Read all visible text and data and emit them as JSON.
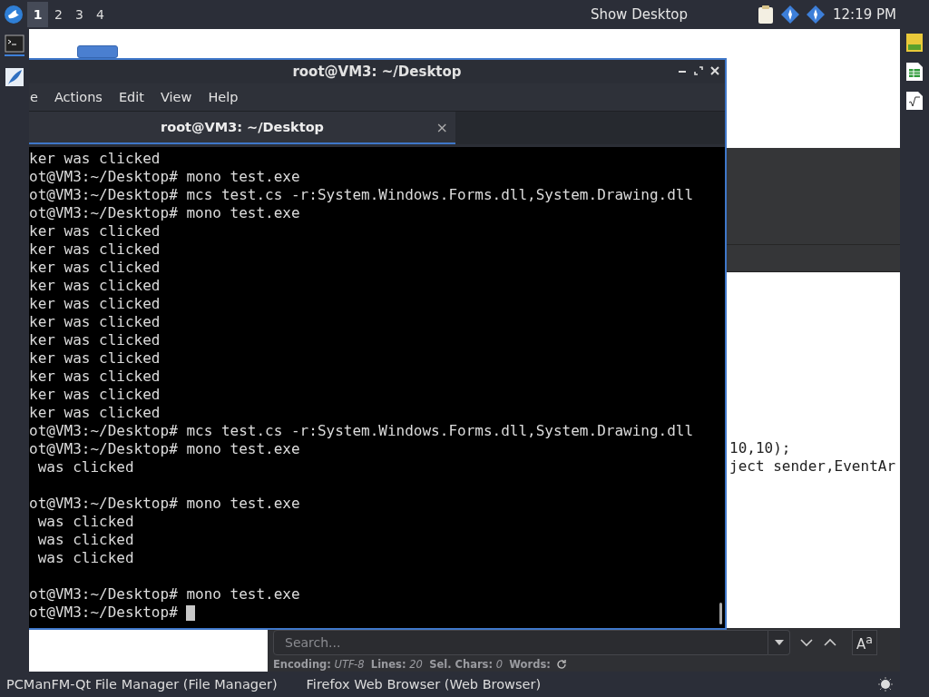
{
  "panel": {
    "workspaces": [
      {
        "label": "1",
        "selected": true
      },
      {
        "label": "2",
        "selected": false
      },
      {
        "label": "3",
        "selected": false
      },
      {
        "label": "4",
        "selected": false
      }
    ],
    "show_desktop": "Show Desktop",
    "clock": "12:19 PM"
  },
  "editor": {
    "code_lines": [
      "10,10);",
      "ject sender,EventAr"
    ],
    "search": {
      "placeholder": "Search..."
    },
    "match_case": "A$^{a}$",
    "status": "**Encoding:** *UTF-8*  **Lines:** *20*  **Sel. Chars:** *0*  **Words:**"
  },
  "terminal": {
    "title": "root@VM3: ~/Desktop",
    "menu": [
      "e",
      "Actions",
      "Edit",
      "View",
      "Help"
    ],
    "tabs": [
      {
        "label": "root@VM3: ~/Desktop",
        "close": "×",
        "selected": true
      }
    ],
    "lines": [
      {
        "kind": "text",
        "text": "ker was clicked"
      },
      {
        "kind": "text",
        "text": "ot@VM3:~/Desktop# mono test.exe"
      },
      {
        "kind": "text",
        "text": "ot@VM3:~/Desktop# mcs test.cs -r:System.Windows.Forms.dll,System.Drawing.dll"
      },
      {
        "kind": "text",
        "text": "ot@VM3:~/Desktop# mono test.exe"
      },
      {
        "kind": "text",
        "text": "ker was clicked"
      },
      {
        "kind": "text",
        "text": "ker was clicked"
      },
      {
        "kind": "text",
        "text": "ker was clicked"
      },
      {
        "kind": "text",
        "text": "ker was clicked"
      },
      {
        "kind": "text",
        "text": "ker was clicked"
      },
      {
        "kind": "text",
        "text": "ker was clicked"
      },
      {
        "kind": "text",
        "text": "ker was clicked"
      },
      {
        "kind": "text",
        "text": "ker was clicked"
      },
      {
        "kind": "text",
        "text": "ker was clicked"
      },
      {
        "kind": "text",
        "text": "ker was clicked"
      },
      {
        "kind": "text",
        "text": "ker was clicked"
      },
      {
        "kind": "text",
        "text": "ot@VM3:~/Desktop# mcs test.cs -r:System.Windows.Forms.dll,System.Drawing.dll"
      },
      {
        "kind": "text",
        "text": "ot@VM3:~/Desktop# mono test.exe"
      },
      {
        "kind": "text",
        "text": " was clicked"
      },
      {
        "kind": "blank"
      },
      {
        "kind": "text",
        "text": "ot@VM3:~/Desktop# mono test.exe"
      },
      {
        "kind": "text",
        "text": " was clicked"
      },
      {
        "kind": "text",
        "text": " was clicked"
      },
      {
        "kind": "text",
        "text": " was clicked"
      },
      {
        "kind": "blank"
      },
      {
        "kind": "text",
        "text": "ot@VM3:~/Desktop# mono test.exe"
      },
      {
        "kind": "prompt",
        "text": "ot@VM3:~/Desktop# "
      }
    ]
  },
  "taskbar": {
    "tasks": [
      "PCManFM-Qt File Manager (File Manager)",
      "Firefox Web Browser (Web Browser)"
    ]
  }
}
